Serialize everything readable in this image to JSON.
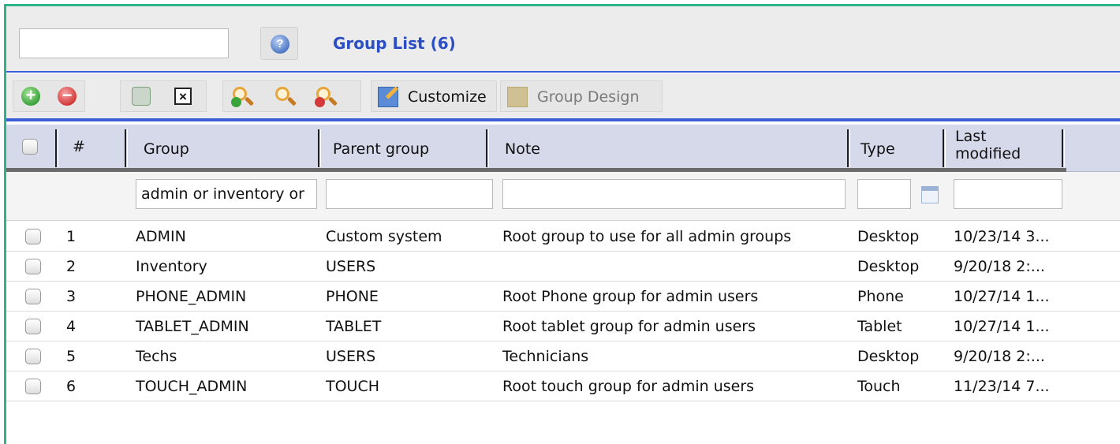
{
  "header": {
    "search_value": "",
    "help_icon": "help-icon",
    "title": "Group List (6)"
  },
  "toolbar": {
    "add_icon": "add-icon",
    "remove_icon": "remove-icon",
    "refresh_icon": "refresh-icon",
    "clear_icon": "clear-icon",
    "zoom_in_icon": "zoom-in-icon",
    "search_icon": "search-icon",
    "zoom_out_icon": "zoom-out-icon",
    "customize_label": "Customize",
    "group_design_label": "Group Design"
  },
  "table": {
    "columns": {
      "num": "#",
      "group": "Group",
      "parent": "Parent group",
      "note": "Note",
      "type": "Type",
      "last_modified_1": "Last",
      "last_modified_2": "modified"
    },
    "filters": {
      "group": "admin or inventory or",
      "parent": "",
      "note": "",
      "type": "",
      "last_modified": ""
    },
    "rows": [
      {
        "num": "1",
        "group": "ADMIN",
        "parent": "Custom system",
        "note": "Root group to use for all admin groups",
        "type": "Desktop",
        "modified": "10/23/14 3..."
      },
      {
        "num": "2",
        "group": "Inventory",
        "parent": "USERS",
        "note": "",
        "type": "Desktop",
        "modified": "9/20/18 2:..."
      },
      {
        "num": "3",
        "group": "PHONE_ADMIN",
        "parent": "PHONE",
        "note": "Root Phone group for admin users",
        "type": "Phone",
        "modified": "10/27/14 1..."
      },
      {
        "num": "4",
        "group": "TABLET_ADMIN",
        "parent": "TABLET",
        "note": "Root tablet group for admin users",
        "type": "Tablet",
        "modified": "10/27/14 1..."
      },
      {
        "num": "5",
        "group": "Techs",
        "parent": "USERS",
        "note": "Technicians",
        "type": "Desktop",
        "modified": "9/20/18 2:..."
      },
      {
        "num": "6",
        "group": "TOUCH_ADMIN",
        "parent": "TOUCH",
        "note": "Root touch group for admin users",
        "type": "Touch",
        "modified": "11/23/14 7..."
      }
    ]
  }
}
